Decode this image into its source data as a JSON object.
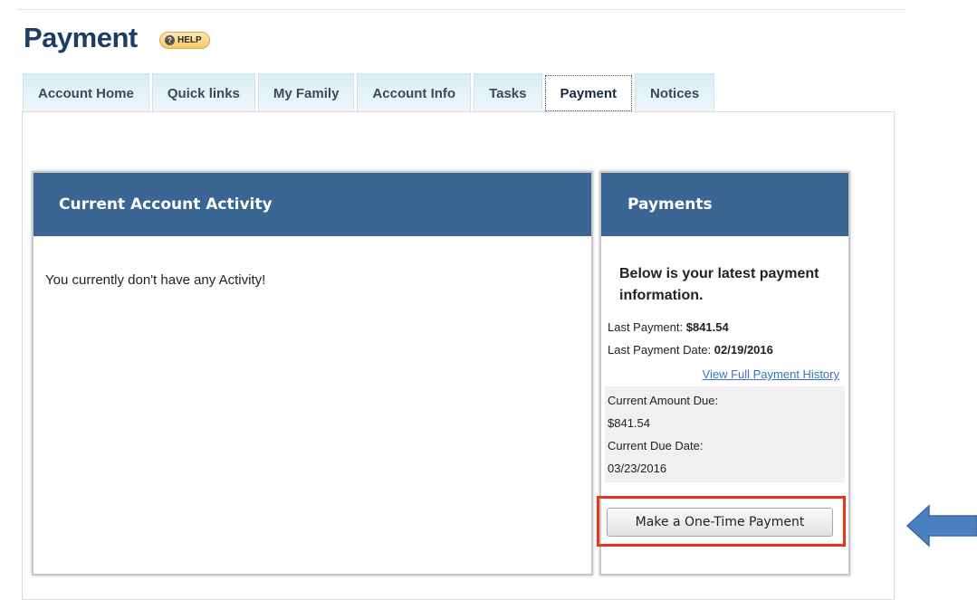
{
  "page": {
    "title": "Payment",
    "help_label": "HELP",
    "help_icon": "question-circle-icon"
  },
  "tabs": [
    {
      "label": "Account Home",
      "active": false
    },
    {
      "label": "Quick links",
      "active": false
    },
    {
      "label": "My Family",
      "active": false
    },
    {
      "label": "Account Info",
      "active": false
    },
    {
      "label": "Tasks",
      "active": false
    },
    {
      "label": "Payment",
      "active": true
    },
    {
      "label": "Notices",
      "active": false
    }
  ],
  "activity": {
    "header": "Current Account Activity",
    "empty_message": "You currently don't have any Activity!"
  },
  "payments": {
    "header": "Payments",
    "intro": "Below is your latest payment information.",
    "last_payment_label": "Last Payment:",
    "last_payment_value": "$841.54",
    "last_payment_date_label": "Last Payment Date:",
    "last_payment_date_value": "02/19/2016",
    "history_link": "View Full Payment History",
    "current_amount_due_label": "Current Amount Due:",
    "current_amount_due_value": "$841.54",
    "current_due_date_label": "Current Due Date:",
    "current_due_date_value": "03/23/2016",
    "one_time_payment_button": "Make a One-Time Payment"
  },
  "colors": {
    "title": "#1f3d64",
    "panel_header": "#3b6593",
    "highlight": "#e8361a",
    "arrow": "#4a7fc0",
    "link": "#3b74c4"
  }
}
